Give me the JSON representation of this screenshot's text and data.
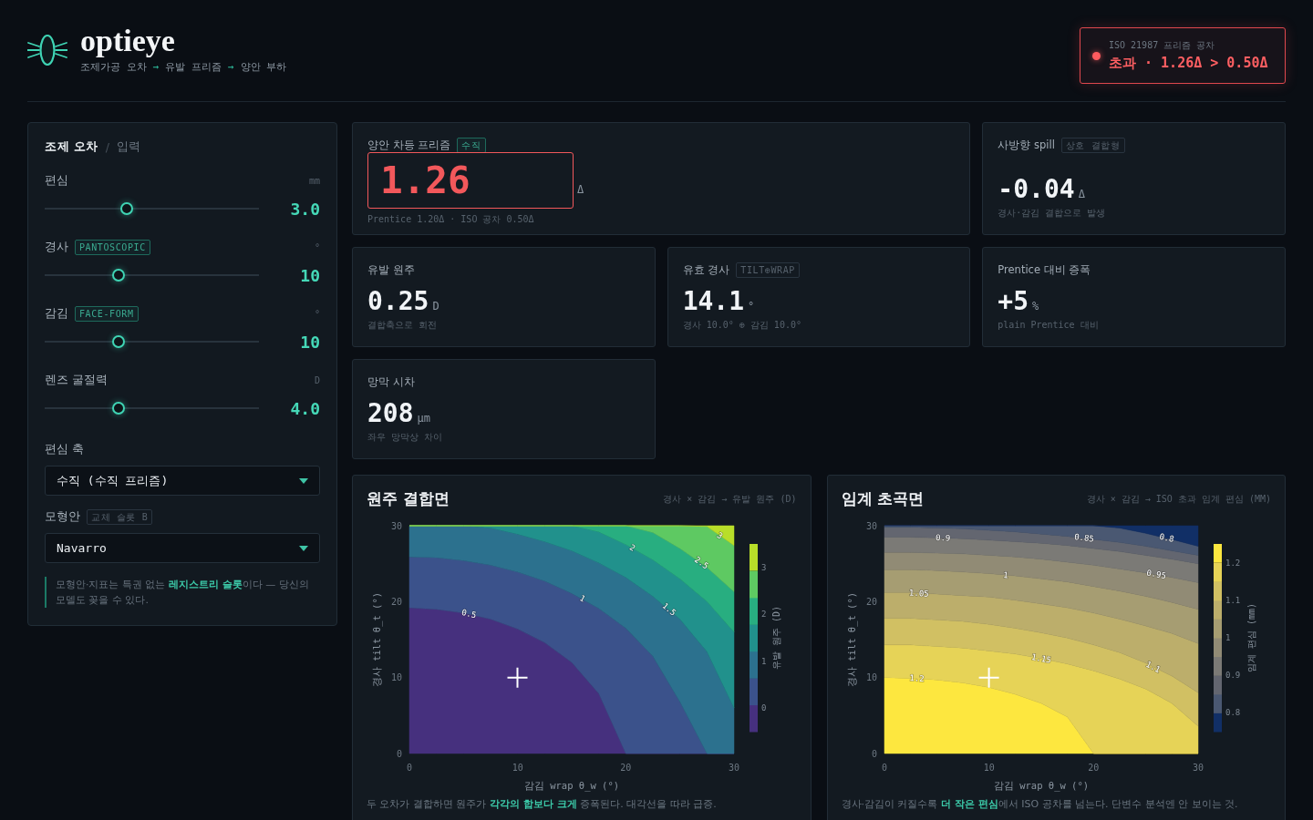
{
  "header": {
    "title": "optieye",
    "pipeline": [
      {
        "kind": "step",
        "text": "조제가공 오차"
      },
      {
        "kind": "arrow",
        "text": "→"
      },
      {
        "kind": "step",
        "text": "유발 프리즘"
      },
      {
        "kind": "arrow",
        "text": "→"
      },
      {
        "kind": "step",
        "text": "양안 부하"
      }
    ],
    "alert": {
      "label": "ISO 21987 프리즘 공차",
      "message": "초과 · 1.26Δ > 0.50Δ",
      "exceeded": true
    }
  },
  "input_panel": {
    "title": "조제 오차",
    "separator": "/",
    "subtitle": "입력",
    "sliders": [
      {
        "label": "편심",
        "unit": "mm",
        "value": "3.0",
        "level": 0.375
      },
      {
        "label": "경사",
        "tag": {
          "text": "PANTOSCOPIC",
          "kind": "accent"
        },
        "unit": "°",
        "value": "10",
        "level": 0.333
      },
      {
        "label": "감김",
        "tag": {
          "text": "FACE-FORM",
          "kind": "accent"
        },
        "unit": "°",
        "value": "10",
        "level": 0.333
      },
      {
        "label": "렌즈 굴절력",
        "unit": "D",
        "value": "4.0",
        "level": 0.333
      }
    ],
    "selects": [
      {
        "label": "편심 축",
        "value": "수직 (수직 프리즘)"
      },
      {
        "label": "모형안",
        "tag": {
          "text": "교체 슬롯 B",
          "kind": "muted"
        },
        "value": "Navarro"
      }
    ],
    "note": "모형안·지표는 특권 없는 **레지스트리 슬롯**이다 — 당신의 모델도 꽂을 수 있다."
  },
  "metrics": [
    {
      "kind": "primary",
      "label": "양안 차등 프리즘",
      "tag": {
        "text": "수직",
        "kind": "accent"
      },
      "value": "1.26",
      "unit": "Δ",
      "detail": "Prentice 1.20Δ · ISO 공차 0.50Δ",
      "alert": true
    },
    {
      "kind": "standard",
      "label": "사방향 spill",
      "tag": {
        "text": "상호 결합형",
        "kind": "muted"
      },
      "value": "-0.04",
      "unit": "Δ",
      "detail": "경사·감김 결합으로 발생",
      "alert": false
    },
    {
      "kind": "standard",
      "label": "유발 원주",
      "value": "0.25",
      "unit": "D",
      "detail": "결합축으로 회전",
      "alert": false
    },
    {
      "kind": "standard",
      "label": "유효 경사",
      "tag": {
        "text": "TILT⊕WRAP",
        "kind": "muted"
      },
      "value": "14.1",
      "unit": "°",
      "detail": "경사 10.0° ⊕ 감김 10.0°",
      "alert": false
    },
    {
      "kind": "standard",
      "label": "Prentice 대비 증폭",
      "value": "+5",
      "unit": "%",
      "detail": "plain Prentice 대비",
      "alert": false
    },
    {
      "kind": "standard",
      "label": "망막 시차",
      "value": "208",
      "unit": "μm",
      "detail": "좌우 망막상 차이",
      "alert": false
    }
  ],
  "plots": [
    {
      "subtitle": "경사 × 감김 → 유발 원주 (D)",
      "chart_data": {
        "type": "area",
        "title": "원주 결합면",
        "xlabel": "감김 wrap θ_w (°)",
        "ylabel": "경사 tilt θ_t (°)",
        "xlim": [
          0,
          30
        ],
        "ylim": [
          0,
          30
        ],
        "xticks": [
          0,
          10,
          20,
          30
        ],
        "yticks": [
          0,
          10,
          20,
          30
        ],
        "x": [
          0,
          2.5,
          5,
          7.5,
          10,
          12.5,
          15,
          17.5,
          20,
          22.5,
          25,
          27.5,
          30
        ],
        "series": [
          {
            "color": "#46307e",
            "values": [
              19.2,
              19.0,
              18.5,
              17.7,
              16.4,
              14.6,
              12.0,
              7.9,
              0,
              0,
              0,
              0,
              0
            ]
          },
          {
            "color": "#3b528b",
            "values": [
              25.9,
              25.8,
              25.4,
              24.8,
              23.9,
              22.7,
              21.1,
              19.1,
              16.5,
              12.8,
              6.8,
              0,
              0
            ]
          },
          {
            "color": "#2c718e",
            "values": [
              30,
              30,
              30,
              29.7,
              28.9,
              27.9,
              26.7,
              25.1,
              23.2,
              20.7,
              17.7,
              13.4,
              6.0
            ]
          },
          {
            "color": "#21918c",
            "values": [
              30,
              30,
              30,
              30,
              30,
              30,
              30,
              29.2,
              27.5,
              25.5,
              23.0,
              20.0,
              16.0
            ]
          },
          {
            "color": "#28ae80",
            "values": [
              30,
              30,
              30,
              30,
              30,
              30,
              30,
              30,
              30,
              29.1,
              27.0,
              24.5,
              21.3
            ]
          },
          {
            "color": "#5ec962",
            "values": [
              30,
              30,
              30,
              30,
              30,
              30,
              30,
              30,
              30,
              30,
              30,
              29.9,
              27.4
            ]
          },
          {
            "color": "#b8de29",
            "values": [
              30,
              30,
              30,
              30,
              30,
              30,
              30,
              30,
              30,
              30,
              30,
              30,
              30
            ]
          }
        ],
        "annotations": [
          {
            "x": 5.5,
            "y": 18.4,
            "text": "0.5"
          },
          {
            "x": 16,
            "y": 20.4,
            "text": "1"
          },
          {
            "x": 24,
            "y": 19,
            "text": "1.5"
          },
          {
            "x": 20.6,
            "y": 27.1,
            "text": "2"
          },
          {
            "x": 27,
            "y": 25.1,
            "text": "2.5"
          },
          {
            "x": 28.7,
            "y": 28.7,
            "text": "3"
          }
        ]
      },
      "colorbar": {
        "label": "유발 원주 (D)",
        "ticks": [
          "3",
          "2",
          "1",
          "0"
        ]
      },
      "caption": "두 오차가 결합하면 원주가 **각각의 합보다 크게** 증폭된다. 대각선을 따라 급증."
    },
    {
      "subtitle": "경사 × 감김 → ISO 초과 임계 편심 (MM)",
      "chart_data": {
        "type": "area",
        "title": "임계 초곡면",
        "xlabel": "감김 wrap θ_w (°)",
        "ylabel": "경사 tilt θ_t (°)",
        "xlim": [
          0,
          30
        ],
        "ylim": [
          0,
          30
        ],
        "xticks": [
          0,
          10,
          20,
          30
        ],
        "yticks": [
          0,
          10,
          20,
          30
        ],
        "x": [
          0,
          2.5,
          5,
          7.5,
          10,
          12.5,
          15,
          17.5,
          20,
          22.5,
          25,
          27.5,
          30
        ],
        "series": [
          {
            "color": "#112f66",
            "values": [
              30,
              30,
              30,
              30,
              30,
              30,
              30,
              30,
              30,
              30,
              30,
              30,
              30
            ]
          },
          {
            "color": "#4a5872",
            "values": [
              30,
              30,
              30,
              30,
              30,
              30,
              30,
              30,
              30,
              29.7,
              29.0,
              28.2,
              27.3
            ]
          },
          {
            "color": "#636670",
            "values": [
              29.8,
              29.8,
              29.7,
              29.6,
              29.4,
              29.2,
              28.9,
              28.6,
              28.2,
              27.8,
              27.3,
              26.7,
              26.1
            ]
          },
          {
            "color": "#7b7a76",
            "values": [
              28.5,
              28.5,
              28.4,
              28.3,
              28.1,
              27.9,
              27.7,
              27.4,
              27.0,
              26.6,
              26.1,
              25.6,
              25.0
            ]
          },
          {
            "color": "#918b75",
            "values": [
              26.5,
              26.5,
              26.4,
              26.3,
              26.1,
              25.9,
              25.6,
              25.2,
              24.8,
              24.3,
              23.8,
              23.2,
              22.5
            ]
          },
          {
            "color": "#a69d72",
            "values": [
              24.2,
              24.2,
              24.1,
              23.9,
              23.7,
              23.4,
              23.0,
              22.6,
              22.0,
              21.4,
              20.7,
              19.9,
              19.0
            ]
          },
          {
            "color": "#bcae6b",
            "values": [
              21.2,
              21.2,
              21.0,
              20.8,
              20.6,
              20.2,
              19.7,
              19.2,
              18.5,
              17.7,
              16.8,
              15.8,
              14.5
            ]
          },
          {
            "color": "#d1c063",
            "values": [
              17.8,
              17.8,
              17.6,
              17.4,
              17.0,
              16.5,
              15.9,
              15.2,
              14.3,
              13.3,
              11.9,
              10.2,
              8.0
            ]
          },
          {
            "color": "#e6d357",
            "values": [
              14.3,
              14.3,
              14.1,
              13.9,
              13.5,
              13.1,
              12.5,
              11.8,
              10.9,
              9.8,
              8.5,
              6.6,
              3.6
            ]
          },
          {
            "color": "#fde73f",
            "values": [
              10,
              9.9,
              9.7,
              9.3,
              8.7,
              7.8,
              6.6,
              4.8,
              0,
              0,
              0,
              0,
              0
            ]
          }
        ],
        "annotations": [
          {
            "x": 5.6,
            "y": 28.4,
            "text": "0.9"
          },
          {
            "x": 19.1,
            "y": 28.4,
            "text": "0.85"
          },
          {
            "x": 27,
            "y": 28.4,
            "text": "0.8"
          },
          {
            "x": 3.3,
            "y": 21.1,
            "text": "1.05"
          },
          {
            "x": 11.6,
            "y": 23.5,
            "text": "1"
          },
          {
            "x": 26,
            "y": 23.6,
            "text": "0.95"
          },
          {
            "x": 15,
            "y": 12.5,
            "text": "1.15"
          },
          {
            "x": 25.7,
            "y": 11.4,
            "text": "1.1"
          },
          {
            "x": 3.1,
            "y": 9.9,
            "text": "1.2"
          }
        ]
      },
      "colorbar": {
        "label": "임계 편심 (mm)",
        "ticks": [
          "1.2",
          "1.1",
          "1",
          "0.9",
          "0.8"
        ]
      },
      "caption": "경사·감김이 커질수록 **더 작은 편심**에서 ISO 공차를 넘는다. 단변수 분석엔 안 보이는 것."
    }
  ]
}
